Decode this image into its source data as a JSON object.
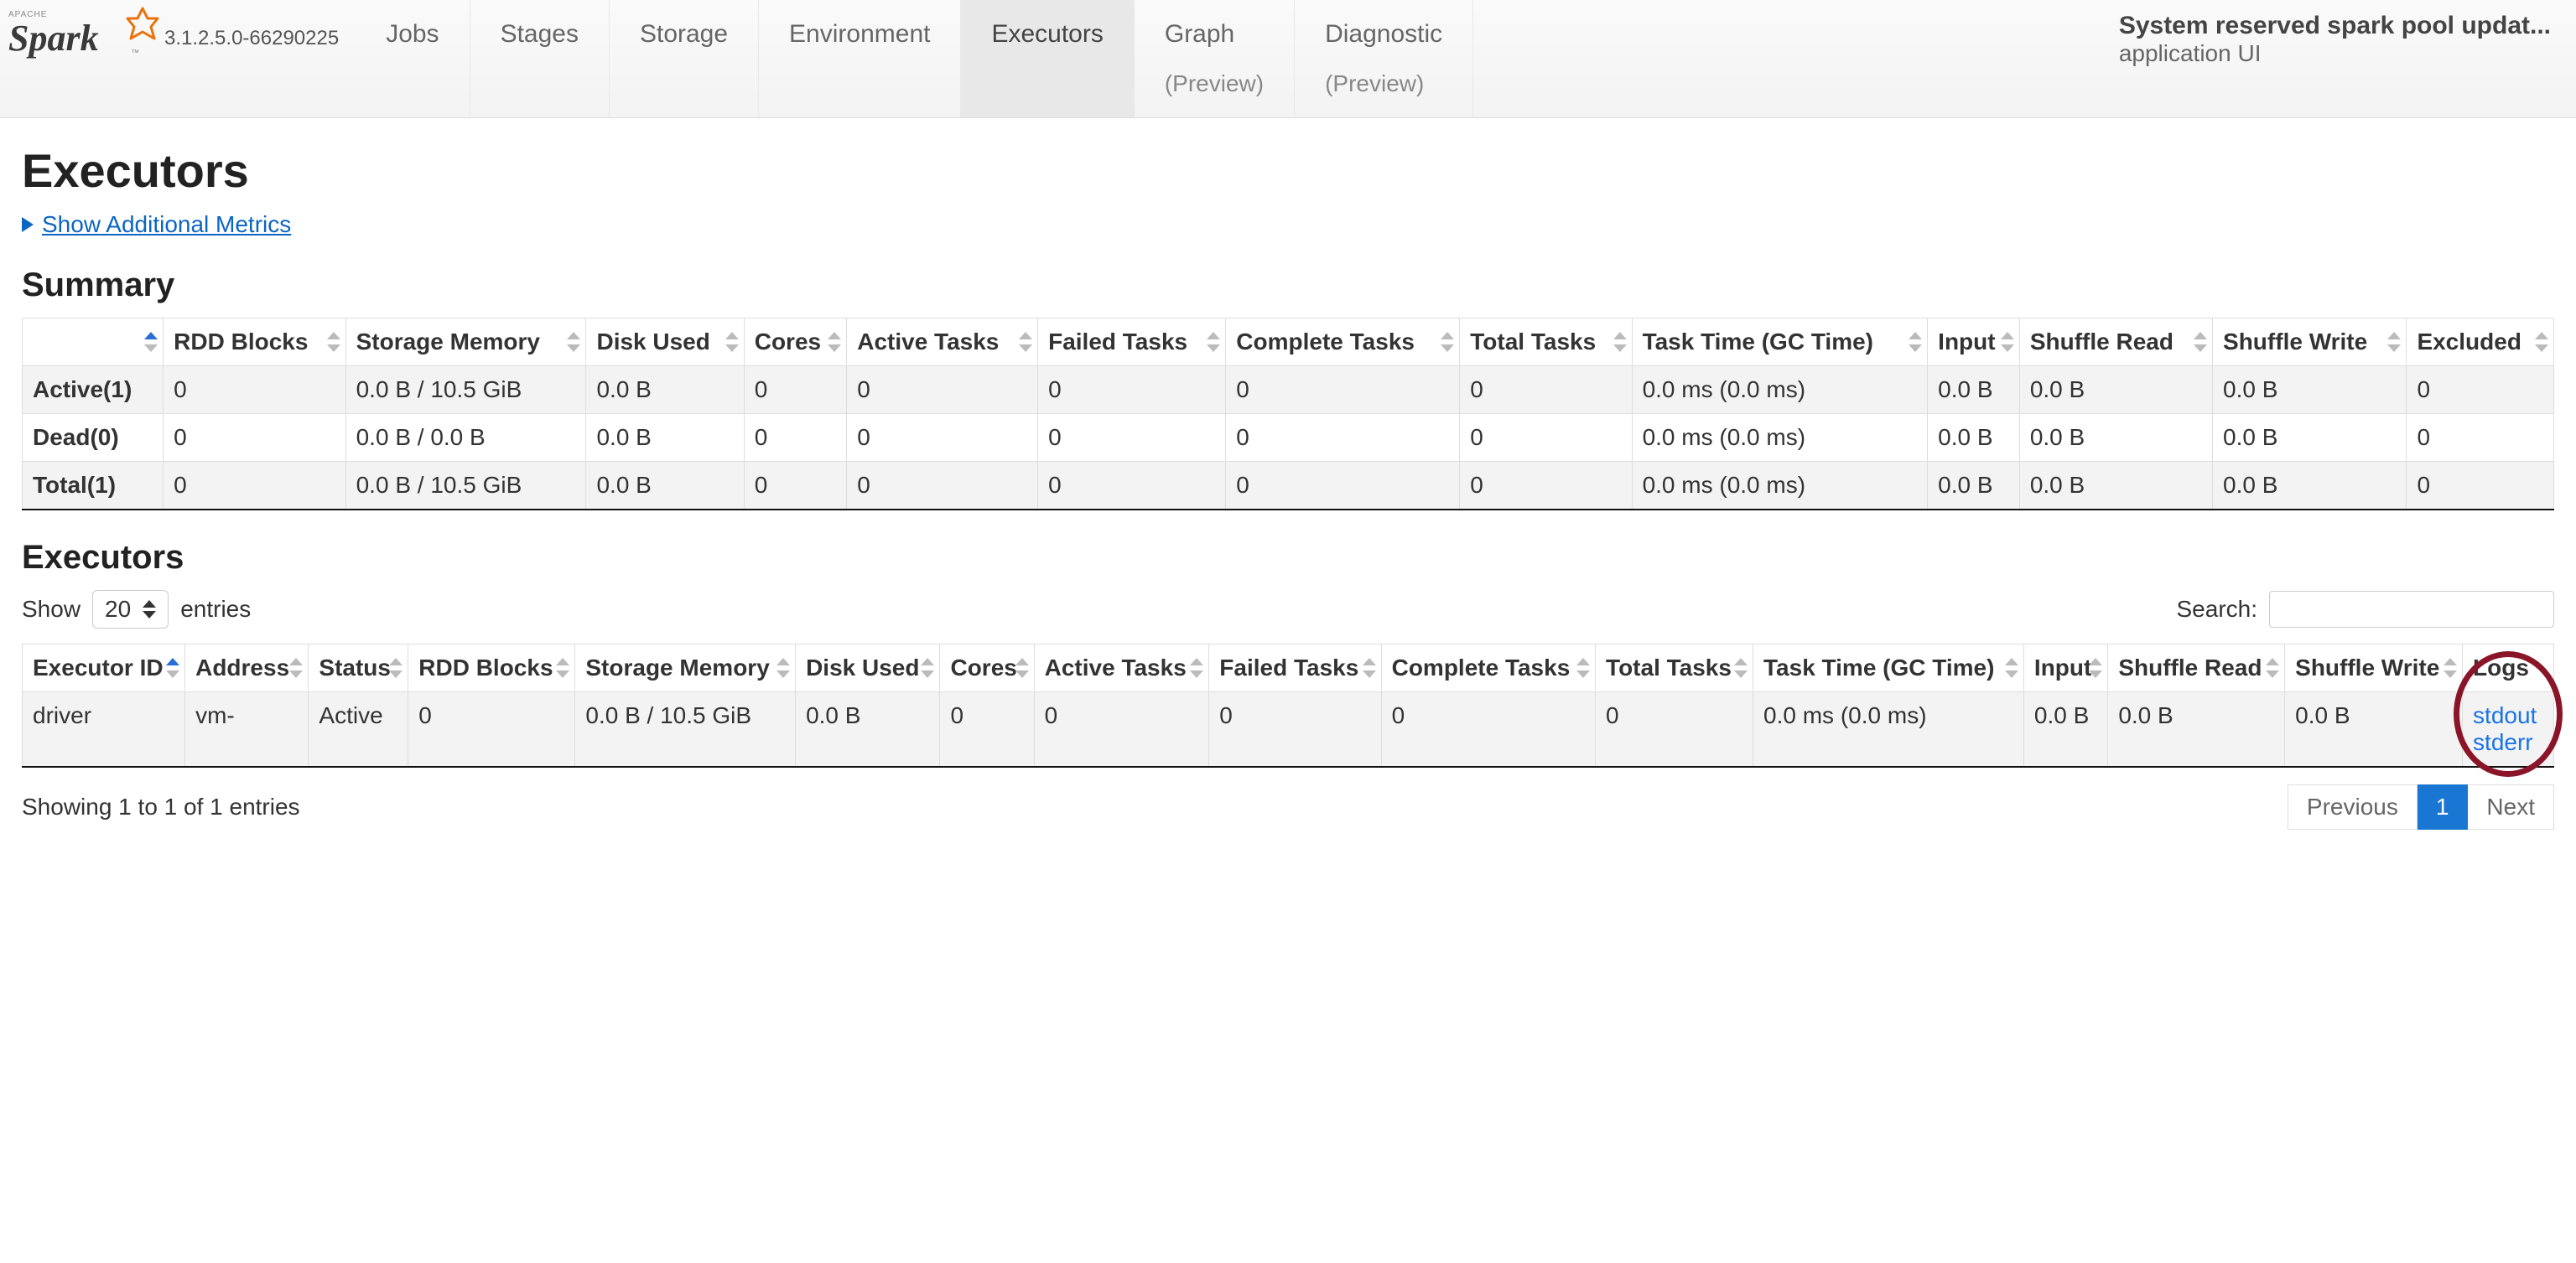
{
  "nav": {
    "version": "3.1.2.5.0-66290225",
    "tabs": [
      {
        "label": "Jobs"
      },
      {
        "label": "Stages"
      },
      {
        "label": "Storage"
      },
      {
        "label": "Environment"
      },
      {
        "label": "Executors"
      },
      {
        "label": "Graph",
        "preview": "(Preview)"
      },
      {
        "label": "Diagnostic",
        "preview": "(Preview)"
      }
    ],
    "active_tab": "Executors",
    "app_title": "System reserved spark pool updat...",
    "app_sub": "application UI"
  },
  "page": {
    "title": "Executors",
    "toggle_metrics": "Show Additional Metrics",
    "summary_heading": "Summary",
    "executors_heading": "Executors"
  },
  "summary_table": {
    "headers": [
      "",
      "RDD Blocks",
      "Storage Memory",
      "Disk Used",
      "Cores",
      "Active Tasks",
      "Failed Tasks",
      "Complete Tasks",
      "Total Tasks",
      "Task Time (GC Time)",
      "Input",
      "Shuffle Read",
      "Shuffle Write",
      "Excluded"
    ],
    "rows": [
      {
        "label": "Active(1)",
        "cells": [
          "0",
          "0.0 B / 10.5 GiB",
          "0.0 B",
          "0",
          "0",
          "0",
          "0",
          "0",
          "0.0 ms (0.0 ms)",
          "0.0 B",
          "0.0 B",
          "0.0 B",
          "0"
        ]
      },
      {
        "label": "Dead(0)",
        "cells": [
          "0",
          "0.0 B / 0.0 B",
          "0.0 B",
          "0",
          "0",
          "0",
          "0",
          "0",
          "0.0 ms (0.0 ms)",
          "0.0 B",
          "0.0 B",
          "0.0 B",
          "0"
        ]
      },
      {
        "label": "Total(1)",
        "cells": [
          "0",
          "0.0 B / 10.5 GiB",
          "0.0 B",
          "0",
          "0",
          "0",
          "0",
          "0",
          "0.0 ms (0.0 ms)",
          "0.0 B",
          "0.0 B",
          "0.0 B",
          "0"
        ]
      }
    ]
  },
  "exec_controls": {
    "show_prefix": "Show",
    "show_value": "20",
    "show_suffix": "entries",
    "search_label": "Search:"
  },
  "exec_table": {
    "headers": [
      "Executor ID",
      "Address",
      "Status",
      "RDD Blocks",
      "Storage Memory",
      "Disk Used",
      "Cores",
      "Active Tasks",
      "Failed Tasks",
      "Complete Tasks",
      "Total Tasks",
      "Task Time (GC Time)",
      "Input",
      "Shuffle Read",
      "Shuffle Write",
      "Logs"
    ],
    "rows": [
      {
        "cells": [
          "driver",
          "vm-",
          "Active",
          "0",
          "0.0 B / 10.5 GiB",
          "0.0 B",
          "0",
          "0",
          "0",
          "0",
          "0",
          "0.0 ms (0.0 ms)",
          "0.0 B",
          "0.0 B",
          "0.0 B"
        ],
        "logs": [
          "stdout",
          "stderr"
        ]
      }
    ]
  },
  "footer": {
    "info": "Showing 1 to 1 of 1 entries",
    "prev": "Previous",
    "page": "1",
    "next": "Next"
  }
}
